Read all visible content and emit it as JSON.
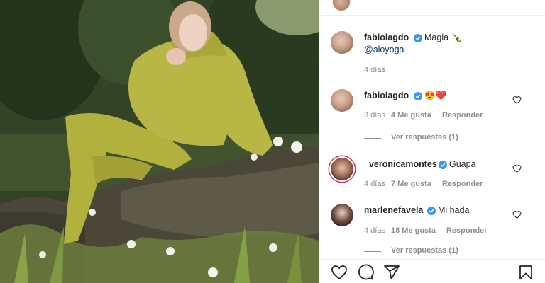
{
  "post": {
    "image_alt": "woman in olive green hoodie and leggings sitting on a rock among trees and white flowers"
  },
  "caption": {
    "username": "fabiolagdo",
    "text": "Magia 🍾",
    "mention": "@aloyoga",
    "time": "4 días"
  },
  "comments": [
    {
      "username": "fabiolagdo",
      "text": "😍❤️",
      "time": "3 días",
      "likes": "4 Me gusta",
      "reply_label": "Responder",
      "view_replies": "Ver respuestas (1)"
    },
    {
      "username": "_veronicamontes",
      "text": "Guapa",
      "time": "4 días",
      "likes": "7 Me gusta",
      "reply_label": "Responder"
    },
    {
      "username": "marlenefavela",
      "text": "Mi hada",
      "time": "4 días",
      "likes": "18 Me gusta",
      "reply_label": "Responder",
      "view_replies": "Ver respuestas (1)"
    }
  ],
  "colors": {
    "verified_badge": "#3897f0",
    "link": "#00376b",
    "meta": "#8e8e8e",
    "story_ring": "#d3346d",
    "hoodie": "#b3b13e"
  },
  "icons": {
    "like": "heart-outline-icon",
    "comment": "comment-bubble-icon",
    "share": "paper-plane-icon",
    "save": "bookmark-icon",
    "verified": "verified-badge-icon"
  }
}
